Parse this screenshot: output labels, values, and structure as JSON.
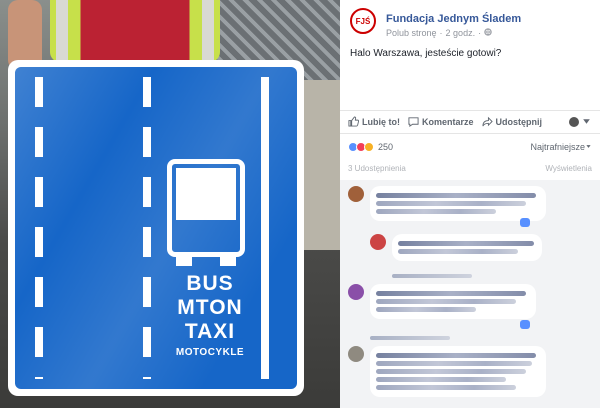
{
  "photo": {
    "sign": {
      "line1": "BUS",
      "line2": "MTON",
      "line3": "TAXI",
      "line4": "MOTOCYKLE"
    }
  },
  "post": {
    "page_name": "Fundacja Jednym Śladem",
    "logo_text": "FJŚ",
    "meta_like": "Polub stronę",
    "meta_sep": "·",
    "meta_time": "2 godz.",
    "meta_globe": "·",
    "text": "Halo Warszawa, jesteście gotowi?"
  },
  "actions": {
    "like": "Lubię to!",
    "comment": "Komentarze",
    "share": "Udostępnij"
  },
  "reactions": {
    "count": "250",
    "sort": "Najtrafniejsze"
  },
  "shares": {
    "left": "3 Udostępnienia",
    "right": "Wyświetlenia"
  },
  "colors": {
    "accent": "#365899",
    "sign_blue": "#1666c8",
    "like_blue": "#5890ff"
  }
}
